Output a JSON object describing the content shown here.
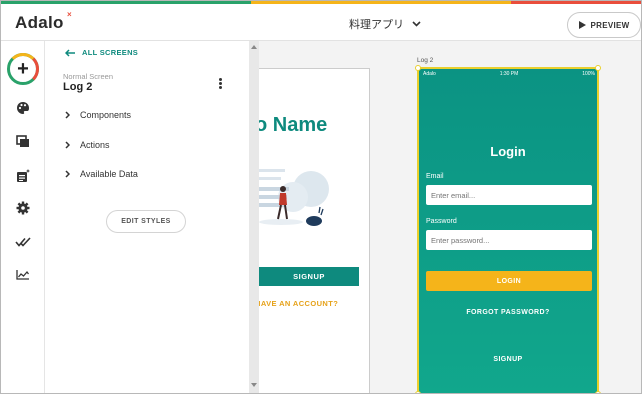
{
  "colors": {
    "stripe": [
      "#2aa26a",
      "#f5b41a",
      "#e94e3c",
      "#d6336c"
    ],
    "brand": "#0e8a7e",
    "accent": "#f5b41a"
  },
  "header": {
    "logo": "Adalo",
    "logo_mark": "×",
    "app_name": "料理アプリ",
    "preview_label": "PREVIEW"
  },
  "rail": {
    "add_symbol": "+",
    "icons": [
      "palette-icon",
      "screens-icon",
      "database-icon",
      "settings-gear-icon",
      "publish-checks-icon",
      "analytics-chart-icon"
    ]
  },
  "panel": {
    "back_label": "ALL SCREENS",
    "screen_type": "Normal Screen",
    "screen_name": "Log 2",
    "sections": [
      "Components",
      "Actions",
      "Available Data"
    ],
    "edit_styles_label": "EDIT STYLES"
  },
  "canvas": {
    "phone1": {
      "title": "o Name",
      "signup_label": "SIGNUP",
      "have_account": "HAVE AN ACCOUNT?"
    },
    "phone2": {
      "screen_label": "Log 2",
      "status": {
        "carrier": "Adalo",
        "time": "1:30 PM",
        "battery": "100%"
      },
      "title": "Login",
      "email_label": "Email",
      "email_placeholder": "Enter email...",
      "password_label": "Password",
      "password_placeholder": "Enter password...",
      "login_label": "LOGIN",
      "forgot_label": "FORGOT PASSWORD?",
      "signup_label": "SIGNUP"
    }
  }
}
